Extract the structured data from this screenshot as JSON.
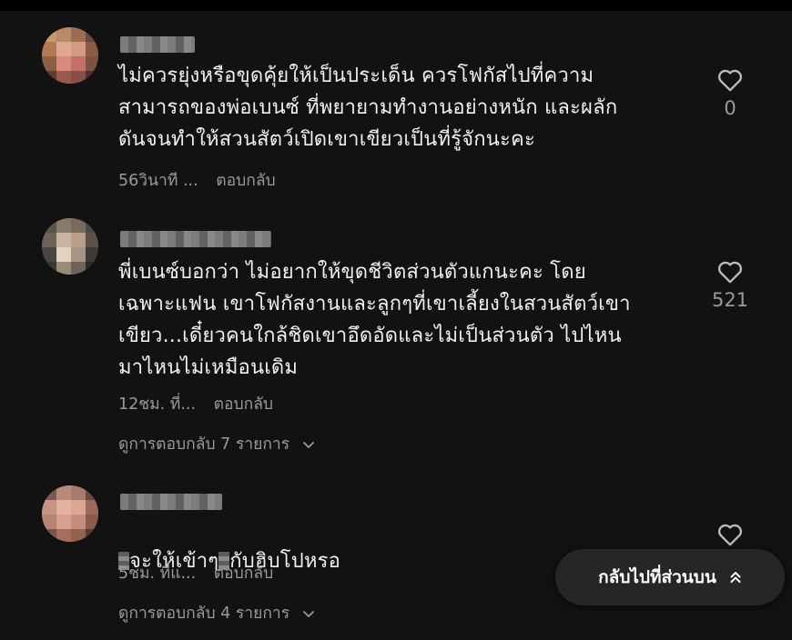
{
  "comments": [
    {
      "text": "ไม่ควรยุ่งหรือขุดคุ้ยให้เป็นประเด็น ควรโฟกัสไปที่ความ\nสามารถของพ่อเบนซ์ ที่พยายามทำงานอย่างหนัก และผลัก\nดันจนทำให้สวนสัตว์เปิดเขาเขียวเป็นที่รู้จักนะคะ",
      "time": "56วินาที ...",
      "reply": "ตอบกลับ",
      "likes": "0"
    },
    {
      "text": "พี่เบนซ์บอกว่า ไม่อยากให้ขุดชีวิตส่วนตัวแกนะคะ โดย\nเฉพาะแฟน เขาโฟกัสงานและลูกๆที่เขาเลี้ยงในสวนสัตว์เขา\nเขียว...เดี๋ยวคนใกล้ชิดเขาอึดอัดและไม่เป็นส่วนตัว ไปไหน\nมาไหนไม่เหมือนเดิม",
      "time": "12ชม. ที่...",
      "reply": "ตอบกลับ",
      "likes": "521",
      "view_replies": "ดูการตอบกลับ 7 รายการ"
    },
    {
      "text_a": "",
      "text_b": "จะให้เข้าๆ",
      "text_c": "กับฮิบโปหรอ",
      "time": "5ชม. ที่แ...",
      "reply": "ตอบกลับ",
      "view_replies": "ดูการตอบกลับ 4 รายการ"
    }
  ],
  "back_to_top": "กลับไปที่ส่วนบน",
  "icons": {
    "like": "heart-outline-icon",
    "expand": "chevron-down-icon",
    "back_to_top": "double-chevron-up-icon"
  },
  "colors": {
    "background": "#121212",
    "text": "#f0f0f0",
    "muted": "#9a9a9a",
    "pill": "#262626"
  }
}
